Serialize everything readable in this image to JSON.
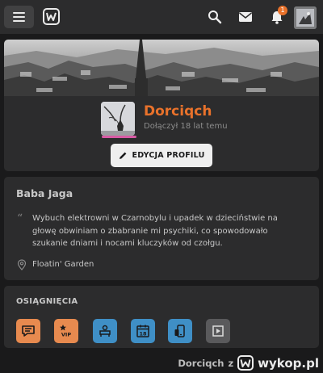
{
  "topbar": {
    "menu_icon": "hamburger-icon",
    "logo_icon": "wykop-logo-icon",
    "icons": [
      "search-icon",
      "mail-icon",
      "bell-icon"
    ],
    "notification_count": "1",
    "accent": "#e9722b"
  },
  "profile": {
    "username": "Dorciqch",
    "joined": "Dołączył 18 lat temu",
    "edit_button": "EDYCJA PROFILU",
    "username_color": "#e9722b",
    "avatar_underline_color": "#d85aa5"
  },
  "about": {
    "display_name": "Baba Jaga",
    "bio": "Wybuch elektrowni w Czarnobylu i upadek w dzieciństwie na głowę obwiniam o zbabranie mi psychiki, co spowodowało szukanie dniami i nocami kluczyków od czołgu.",
    "location": "Floatin' Garden"
  },
  "achievements": {
    "title": "OSIĄGNIĘCIA",
    "badges": [
      {
        "icon": "chat-bubble-icon",
        "color": "#e78a4f"
      },
      {
        "icon": "vip-star-icon",
        "color": "#e78a4f"
      },
      {
        "icon": "user-desk-icon",
        "color": "#3f8fc6"
      },
      {
        "icon": "calendar-18-icon",
        "color": "#3f8fc6"
      },
      {
        "icon": "mobile-app-icon",
        "color": "#3f8fc6"
      },
      {
        "icon": "microblog-icon",
        "color": "#5a5a5c"
      }
    ]
  },
  "watermark": {
    "author": "Dorciqch",
    "by": "z",
    "site": "wykop.pl"
  }
}
